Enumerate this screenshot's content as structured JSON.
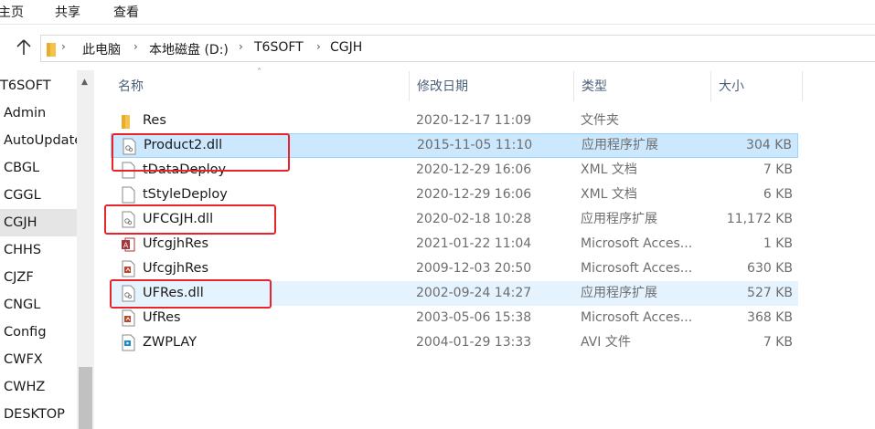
{
  "ribbon": {
    "tabs": [
      "主页",
      "共享",
      "查看"
    ]
  },
  "address": {
    "crumbs": [
      "此电脑",
      "本地磁盘 (D:)",
      "T6SOFT",
      "CGJH"
    ]
  },
  "nav": {
    "items": [
      "T6SOFT",
      "Admin",
      "AutoUpdate",
      "CBGL",
      "CGGL",
      "CGJH",
      "CHHS",
      "CJZF",
      "CNGL",
      "Config",
      "CWFX",
      "CWHZ",
      "DESKTOP"
    ]
  },
  "columns": {
    "name": "名称",
    "date": "修改日期",
    "type": "类型",
    "size": "大小"
  },
  "files": [
    {
      "name": "Res",
      "date": "2020-12-17 11:09",
      "type": "文件夹",
      "size": "",
      "icon": "folder-icon"
    },
    {
      "name": "Product2.dll",
      "date": "2015-11-05 11:10",
      "type": "应用程序扩展",
      "size": "304 KB",
      "icon": "dll-file-icon"
    },
    {
      "name": "tDataDeploy",
      "date": "2020-12-29 16:06",
      "type": "XML 文档",
      "size": "7 KB",
      "icon": "document-icon"
    },
    {
      "name": "tStyleDeploy",
      "date": "2020-12-29 16:06",
      "type": "XML 文档",
      "size": "6 KB",
      "icon": "document-icon"
    },
    {
      "name": "UFCGJH.dll",
      "date": "2020-02-18 10:28",
      "type": "应用程序扩展",
      "size": "11,172 KB",
      "icon": "dll-file-icon"
    },
    {
      "name": "UfcgjhRes",
      "date": "2021-01-22 11:04",
      "type": "Microsoft Acces...",
      "size": "1 KB",
      "icon": "access-db-icon"
    },
    {
      "name": "UfcgjhRes",
      "date": "2009-12-03 20:50",
      "type": "Microsoft Acces...",
      "size": "630 KB",
      "icon": "access-db-file-icon"
    },
    {
      "name": "UFRes.dll",
      "date": "2002-09-24 14:27",
      "type": "应用程序扩展",
      "size": "527 KB",
      "icon": "dll-file-icon"
    },
    {
      "name": "UfRes",
      "date": "2003-05-06 15:38",
      "type": "Microsoft Acces...",
      "size": "368 KB",
      "icon": "access-db-file-icon"
    },
    {
      "name": "ZWPLAY",
      "date": "2004-01-29 13:33",
      "type": "AVI 文件",
      "size": "7 KB",
      "icon": "video-file-icon"
    }
  ],
  "colors": {
    "selection": "#cce8ff",
    "hover": "#e5f3ff",
    "highlight_box": "#e8232a"
  }
}
